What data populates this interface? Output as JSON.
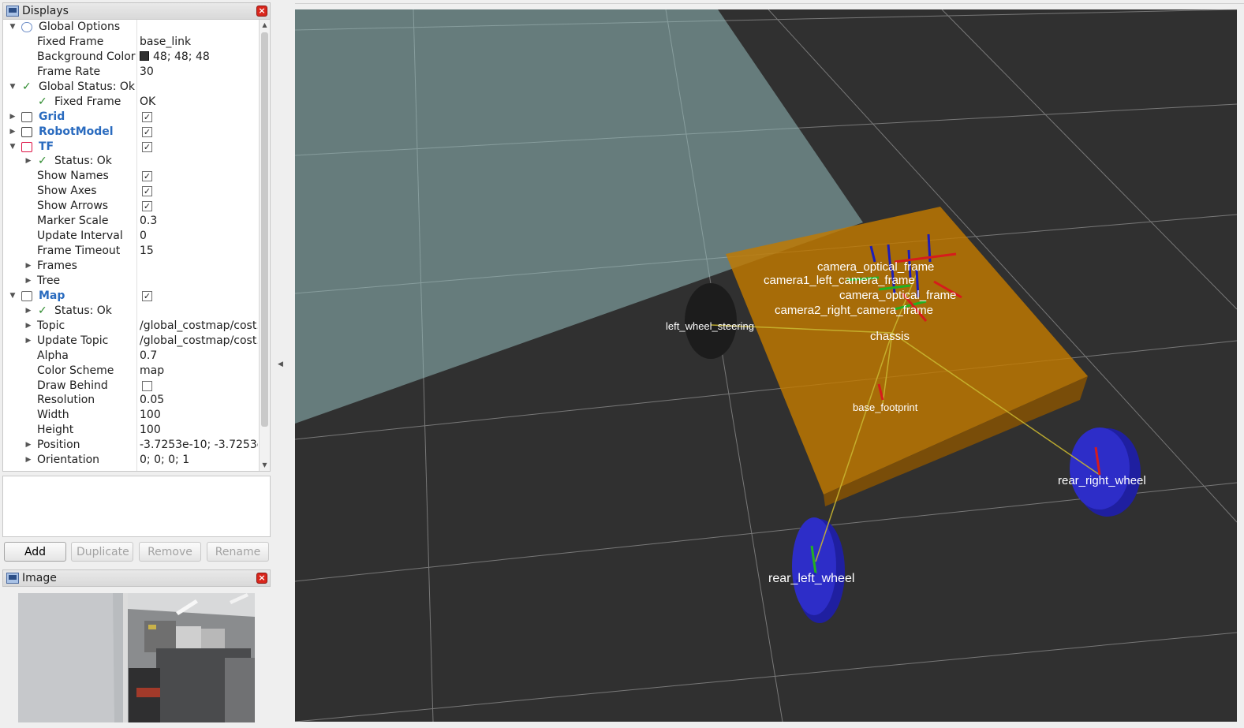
{
  "displays_panel": {
    "title": "Displays",
    "tree": [
      {
        "name": "Global Options",
        "indent": 0,
        "arrow": "down",
        "icon": "gear-icon"
      },
      {
        "name": "Fixed Frame",
        "indent": 1,
        "value": "base_link"
      },
      {
        "name": "Background Color",
        "indent": 1,
        "value": "48; 48; 48",
        "swatch": "#303030"
      },
      {
        "name": "Frame Rate",
        "indent": 1,
        "value": "30"
      },
      {
        "name": "Global Status: Ok",
        "indent": 0,
        "arrow": "down",
        "status": "ok"
      },
      {
        "name": "Fixed Frame",
        "indent": 1,
        "value": "OK",
        "status": "ok"
      },
      {
        "name": "Grid",
        "indent": 0,
        "arrow": "right",
        "plugin": true,
        "checkbox": true,
        "icon": "grid-icon"
      },
      {
        "name": "RobotModel",
        "indent": 0,
        "arrow": "right",
        "plugin": true,
        "checkbox": true,
        "icon": "robot-icon"
      },
      {
        "name": "TF",
        "indent": 0,
        "arrow": "down",
        "plugin": true,
        "checkbox": true,
        "icon": "axes-icon"
      },
      {
        "name": "Status: Ok",
        "indent": 1,
        "arrow": "right",
        "status": "ok"
      },
      {
        "name": "Show Names",
        "indent": 1,
        "checkbox": true
      },
      {
        "name": "Show Axes",
        "indent": 1,
        "checkbox": true
      },
      {
        "name": "Show Arrows",
        "indent": 1,
        "checkbox": true
      },
      {
        "name": "Marker Scale",
        "indent": 1,
        "value": "0.3"
      },
      {
        "name": "Update Interval",
        "indent": 1,
        "value": "0"
      },
      {
        "name": "Frame Timeout",
        "indent": 1,
        "value": "15"
      },
      {
        "name": "Frames",
        "indent": 1,
        "arrow": "right"
      },
      {
        "name": "Tree",
        "indent": 1,
        "arrow": "right"
      },
      {
        "name": "Map",
        "indent": 0,
        "arrow": "down",
        "plugin": true,
        "checkbox": true,
        "icon": "map-icon"
      },
      {
        "name": "Status: Ok",
        "indent": 1,
        "arrow": "right",
        "status": "ok"
      },
      {
        "name": "Topic",
        "indent": 1,
        "arrow": "right",
        "value": "/global_costmap/cost..."
      },
      {
        "name": "Update Topic",
        "indent": 1,
        "arrow": "right",
        "value": "/global_costmap/cost..."
      },
      {
        "name": "Alpha",
        "indent": 1,
        "value": "0.7"
      },
      {
        "name": "Color Scheme",
        "indent": 1,
        "value": "map"
      },
      {
        "name": "Draw Behind",
        "indent": 1,
        "checkbox": false
      },
      {
        "name": "Resolution",
        "indent": 1,
        "value": "0.05"
      },
      {
        "name": "Width",
        "indent": 1,
        "value": "100"
      },
      {
        "name": "Height",
        "indent": 1,
        "value": "100"
      },
      {
        "name": "Position",
        "indent": 1,
        "arrow": "right",
        "value": "-3.7253e-10; -3.7253e..."
      },
      {
        "name": "Orientation",
        "indent": 1,
        "arrow": "right",
        "value": "0; 0; 0; 1"
      }
    ]
  },
  "buttons": {
    "add": "Add",
    "duplicate": "Duplicate",
    "remove": "Remove",
    "rename": "Rename"
  },
  "image_panel": {
    "title": "Image"
  },
  "scene": {
    "background": "#303030",
    "tf_labels": {
      "left_wheel": "left_wheel_steering",
      "chassis": "chassis",
      "base": "base_footprint",
      "rear_right": "rear_right_wheel",
      "rear_left": "rear_left_wheel",
      "camera_a": "camera_optical_frame",
      "camera_b": "camera1_left_camera_frame",
      "camera_c": "camera_optical_frame",
      "camera_d": "camera2_right_camera_frame"
    }
  }
}
